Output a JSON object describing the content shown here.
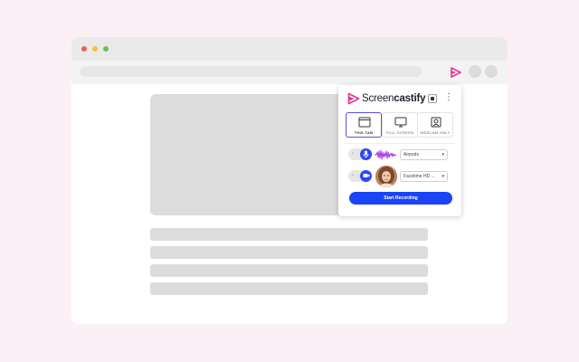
{
  "colors": {
    "page_background": "#fcf0f7",
    "brand_pink": "#e8338e",
    "accent_blue": "#1a44f5",
    "active_border": "#5a4ef0",
    "wave_purple": "#a437e6"
  },
  "browser": {
    "window_dots": [
      "close",
      "minimize",
      "maximize"
    ],
    "extension_icon": "screencastify-icon",
    "placeholder_bars": 4
  },
  "popup": {
    "brand_regular": "Screen",
    "brand_bold": "castify",
    "menu_icon": "kebab-menu-icon",
    "modes": [
      {
        "label": "THIS TAB",
        "icon": "browser-tab-icon",
        "active": true
      },
      {
        "label": "FULL SCREEN",
        "icon": "monitor-icon",
        "active": false
      },
      {
        "label": "WEBCAM ONLY",
        "icon": "webcam-icon",
        "active": false
      }
    ],
    "microphone": {
      "toggle_off_text": "‹",
      "icon": "microphone-icon",
      "enabled": true,
      "device": "Airpods"
    },
    "webcam": {
      "toggle_off_text": "‹",
      "icon": "camera-icon",
      "enabled": true,
      "device": "Facetime HD ..."
    },
    "dropdown_arrow": "▾",
    "start_button": "Start Recording"
  }
}
